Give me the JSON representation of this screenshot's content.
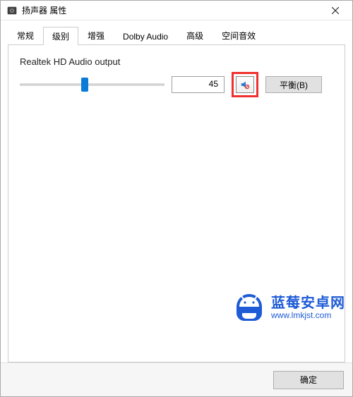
{
  "window": {
    "title": "扬声器 属性"
  },
  "tabs": [
    {
      "label": "常规",
      "active": false
    },
    {
      "label": "级别",
      "active": true
    },
    {
      "label": "增强",
      "active": false
    },
    {
      "label": "Dolby Audio",
      "active": false
    },
    {
      "label": "高级",
      "active": false
    },
    {
      "label": "空间音效",
      "active": false
    }
  ],
  "level": {
    "section_label": "Realtek HD Audio output",
    "value": "45",
    "slider_percent": 45,
    "muted": true,
    "balance_label": "平衡(B)"
  },
  "footer": {
    "ok": "确定"
  },
  "watermark": {
    "text_cn": "蓝莓安卓网",
    "text_en": "www.lmkjst.com"
  }
}
